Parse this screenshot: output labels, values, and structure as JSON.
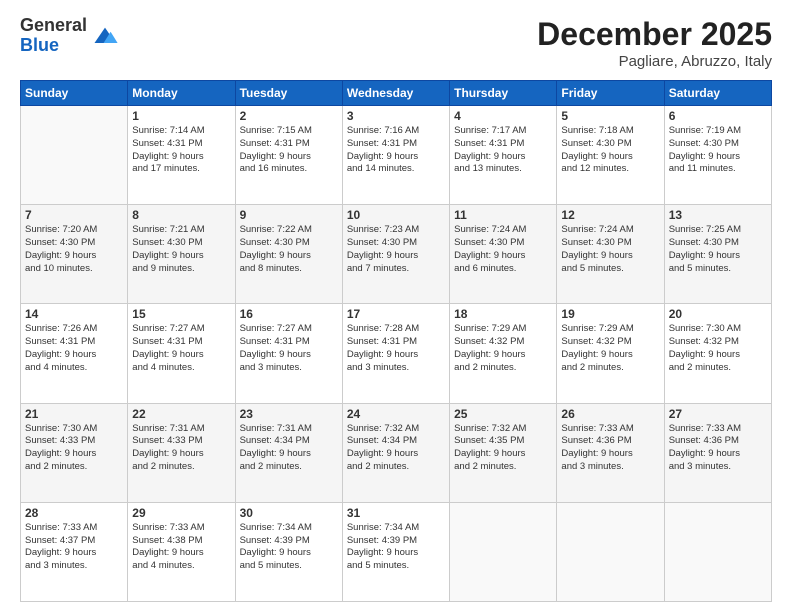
{
  "logo": {
    "general": "General",
    "blue": "Blue"
  },
  "title": "December 2025",
  "location": "Pagliare, Abruzzo, Italy",
  "weekdays": [
    "Sunday",
    "Monday",
    "Tuesday",
    "Wednesday",
    "Thursday",
    "Friday",
    "Saturday"
  ],
  "weeks": [
    [
      {
        "day": "",
        "info": ""
      },
      {
        "day": "1",
        "info": "Sunrise: 7:14 AM\nSunset: 4:31 PM\nDaylight: 9 hours\nand 17 minutes."
      },
      {
        "day": "2",
        "info": "Sunrise: 7:15 AM\nSunset: 4:31 PM\nDaylight: 9 hours\nand 16 minutes."
      },
      {
        "day": "3",
        "info": "Sunrise: 7:16 AM\nSunset: 4:31 PM\nDaylight: 9 hours\nand 14 minutes."
      },
      {
        "day": "4",
        "info": "Sunrise: 7:17 AM\nSunset: 4:31 PM\nDaylight: 9 hours\nand 13 minutes."
      },
      {
        "day": "5",
        "info": "Sunrise: 7:18 AM\nSunset: 4:30 PM\nDaylight: 9 hours\nand 12 minutes."
      },
      {
        "day": "6",
        "info": "Sunrise: 7:19 AM\nSunset: 4:30 PM\nDaylight: 9 hours\nand 11 minutes."
      }
    ],
    [
      {
        "day": "7",
        "info": "Sunrise: 7:20 AM\nSunset: 4:30 PM\nDaylight: 9 hours\nand 10 minutes."
      },
      {
        "day": "8",
        "info": "Sunrise: 7:21 AM\nSunset: 4:30 PM\nDaylight: 9 hours\nand 9 minutes."
      },
      {
        "day": "9",
        "info": "Sunrise: 7:22 AM\nSunset: 4:30 PM\nDaylight: 9 hours\nand 8 minutes."
      },
      {
        "day": "10",
        "info": "Sunrise: 7:23 AM\nSunset: 4:30 PM\nDaylight: 9 hours\nand 7 minutes."
      },
      {
        "day": "11",
        "info": "Sunrise: 7:24 AM\nSunset: 4:30 PM\nDaylight: 9 hours\nand 6 minutes."
      },
      {
        "day": "12",
        "info": "Sunrise: 7:24 AM\nSunset: 4:30 PM\nDaylight: 9 hours\nand 5 minutes."
      },
      {
        "day": "13",
        "info": "Sunrise: 7:25 AM\nSunset: 4:30 PM\nDaylight: 9 hours\nand 5 minutes."
      }
    ],
    [
      {
        "day": "14",
        "info": "Sunrise: 7:26 AM\nSunset: 4:31 PM\nDaylight: 9 hours\nand 4 minutes."
      },
      {
        "day": "15",
        "info": "Sunrise: 7:27 AM\nSunset: 4:31 PM\nDaylight: 9 hours\nand 4 minutes."
      },
      {
        "day": "16",
        "info": "Sunrise: 7:27 AM\nSunset: 4:31 PM\nDaylight: 9 hours\nand 3 minutes."
      },
      {
        "day": "17",
        "info": "Sunrise: 7:28 AM\nSunset: 4:31 PM\nDaylight: 9 hours\nand 3 minutes."
      },
      {
        "day": "18",
        "info": "Sunrise: 7:29 AM\nSunset: 4:32 PM\nDaylight: 9 hours\nand 2 minutes."
      },
      {
        "day": "19",
        "info": "Sunrise: 7:29 AM\nSunset: 4:32 PM\nDaylight: 9 hours\nand 2 minutes."
      },
      {
        "day": "20",
        "info": "Sunrise: 7:30 AM\nSunset: 4:32 PM\nDaylight: 9 hours\nand 2 minutes."
      }
    ],
    [
      {
        "day": "21",
        "info": "Sunrise: 7:30 AM\nSunset: 4:33 PM\nDaylight: 9 hours\nand 2 minutes."
      },
      {
        "day": "22",
        "info": "Sunrise: 7:31 AM\nSunset: 4:33 PM\nDaylight: 9 hours\nand 2 minutes."
      },
      {
        "day": "23",
        "info": "Sunrise: 7:31 AM\nSunset: 4:34 PM\nDaylight: 9 hours\nand 2 minutes."
      },
      {
        "day": "24",
        "info": "Sunrise: 7:32 AM\nSunset: 4:34 PM\nDaylight: 9 hours\nand 2 minutes."
      },
      {
        "day": "25",
        "info": "Sunrise: 7:32 AM\nSunset: 4:35 PM\nDaylight: 9 hours\nand 2 minutes."
      },
      {
        "day": "26",
        "info": "Sunrise: 7:33 AM\nSunset: 4:36 PM\nDaylight: 9 hours\nand 3 minutes."
      },
      {
        "day": "27",
        "info": "Sunrise: 7:33 AM\nSunset: 4:36 PM\nDaylight: 9 hours\nand 3 minutes."
      }
    ],
    [
      {
        "day": "28",
        "info": "Sunrise: 7:33 AM\nSunset: 4:37 PM\nDaylight: 9 hours\nand 3 minutes."
      },
      {
        "day": "29",
        "info": "Sunrise: 7:33 AM\nSunset: 4:38 PM\nDaylight: 9 hours\nand 4 minutes."
      },
      {
        "day": "30",
        "info": "Sunrise: 7:34 AM\nSunset: 4:39 PM\nDaylight: 9 hours\nand 5 minutes."
      },
      {
        "day": "31",
        "info": "Sunrise: 7:34 AM\nSunset: 4:39 PM\nDaylight: 9 hours\nand 5 minutes."
      },
      {
        "day": "",
        "info": ""
      },
      {
        "day": "",
        "info": ""
      },
      {
        "day": "",
        "info": ""
      }
    ]
  ]
}
